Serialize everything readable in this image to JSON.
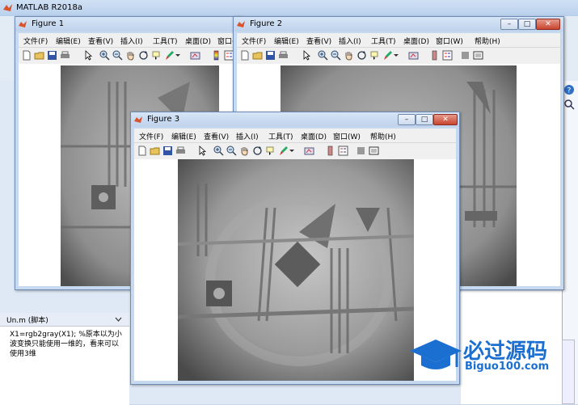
{
  "app": {
    "title": "MATLAB R2018a"
  },
  "menu_items": [
    "文件(F)",
    "编辑(E)",
    "查看(V)",
    "插入(I)",
    "工具(T)",
    "桌面(D)",
    "窗口(W)",
    "帮助(H)"
  ],
  "figures": {
    "fig1": {
      "title": "Figure 1"
    },
    "fig2": {
      "title": "Figure 2"
    },
    "fig3": {
      "title": "Figure 3"
    }
  },
  "window_buttons": {
    "minimize": "–",
    "maximize": "□",
    "close": "✕"
  },
  "editor": {
    "tab_label": "Un.m  (脚本)",
    "text": "X1=rgb2gray(X1); %原本以为小波变换只能使用一维的，看来可以使用3维"
  },
  "watermark": {
    "cn": "必过源码",
    "en": "Biguo100.com"
  },
  "colors": {
    "title_bar": "#c6d9ef",
    "close_button": "#c8442f",
    "watermark_blue": "#1b6fd1"
  }
}
